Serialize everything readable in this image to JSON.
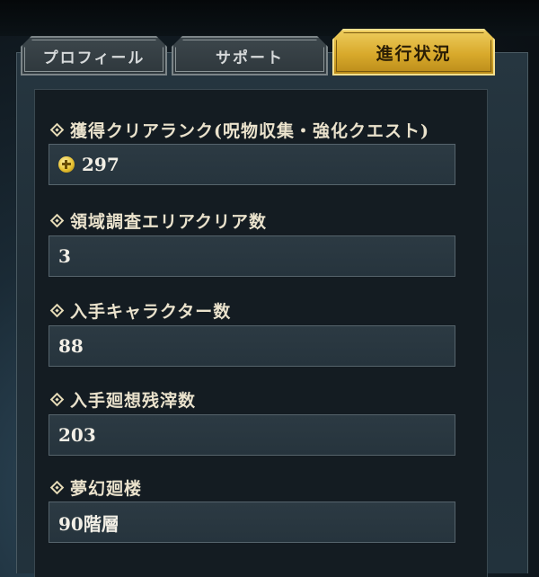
{
  "tabs": [
    {
      "label": "プロフィール",
      "active": false
    },
    {
      "label": "サポート",
      "active": false
    },
    {
      "label": "進行状況",
      "active": true
    }
  ],
  "fields": [
    {
      "label": "獲得クリアランク(呪物収集・強化クエスト)",
      "value": "297",
      "icon": "rank-medal-icon"
    },
    {
      "label": "領域調査エリアクリア数",
      "value": "3"
    },
    {
      "label": "入手キャラクター数",
      "value": "88"
    },
    {
      "label": "入手廻想残滓数",
      "value": "203"
    },
    {
      "label": "夢幻廻楼",
      "value": "90階層"
    }
  ],
  "colors": {
    "active_tab": "#d8a92b",
    "inactive_tab": "#3d474c",
    "panel": "#141c22",
    "value_box": "#2c3a43",
    "label_text": "#eae2cc"
  }
}
